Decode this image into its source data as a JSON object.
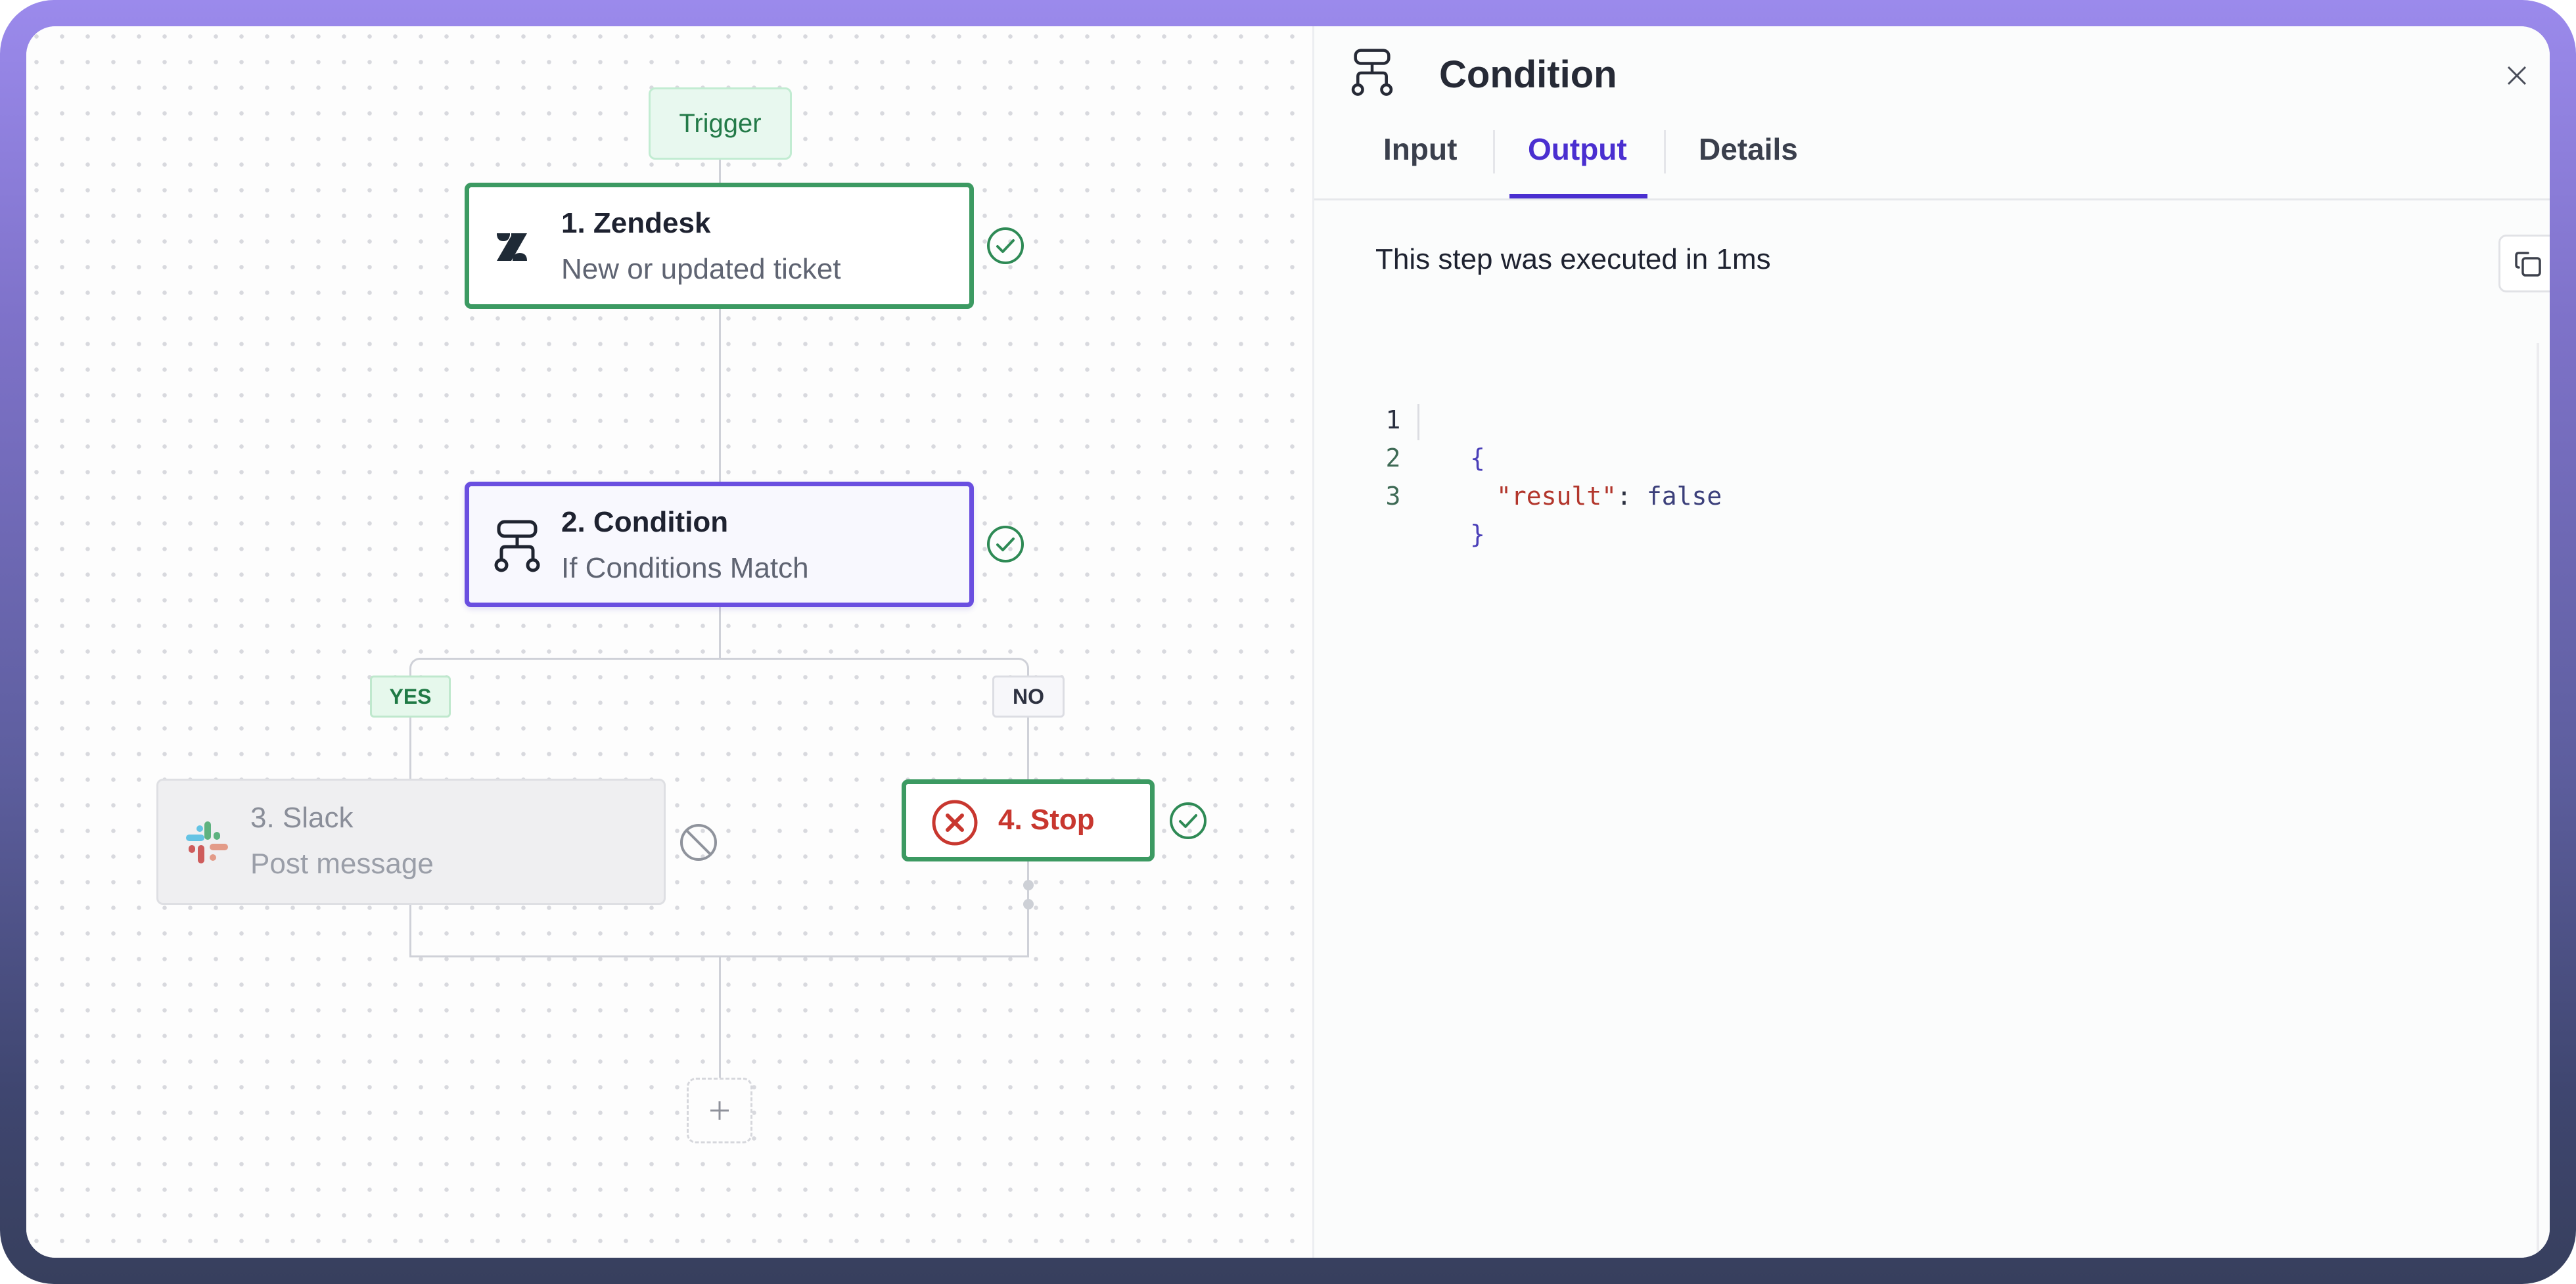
{
  "canvas": {
    "trigger_label": "Trigger",
    "nodes": [
      {
        "number": "1",
        "title": "1. Zendesk",
        "subtitle": "New or updated ticket",
        "app_icon": "zendesk-logo",
        "status": "success"
      },
      {
        "number": "2",
        "title": "2. Condition",
        "subtitle": "If Conditions Match",
        "app_icon": "condition-branch",
        "status": "success",
        "selected": true
      },
      {
        "number": "3",
        "title": "3. Slack",
        "subtitle": "Post message",
        "app_icon": "slack-logo",
        "status": "skipped"
      },
      {
        "number": "4",
        "title": "4. Stop",
        "subtitle": "",
        "app_icon": "stop-x-circle",
        "status": "success"
      }
    ],
    "branches": {
      "yes_label": "YES",
      "no_label": "NO"
    },
    "add_step_label": "+"
  },
  "panel": {
    "title": "Condition",
    "title_icon": "condition-branch",
    "close_label": "×",
    "tabs": [
      {
        "label": "Input",
        "active": false
      },
      {
        "label": "Output",
        "active": true
      },
      {
        "label": "Details",
        "active": false
      }
    ],
    "execution_text": "This step was executed in 1ms",
    "copy_icon": "copy",
    "code": {
      "line_numbers": [
        "1",
        "2",
        "3"
      ],
      "open_brace": "{",
      "key": "\"result\"",
      "colon": ":",
      "value": "false",
      "close_brace": "}"
    }
  },
  "colors": {
    "success_green": "#3c9a62",
    "selected_purple": "#6a4fe0",
    "active_tab": "#4a2fd0",
    "stop_red": "#c8372f",
    "frame_top": "#9b8aec",
    "frame_bottom": "#373f5d"
  }
}
